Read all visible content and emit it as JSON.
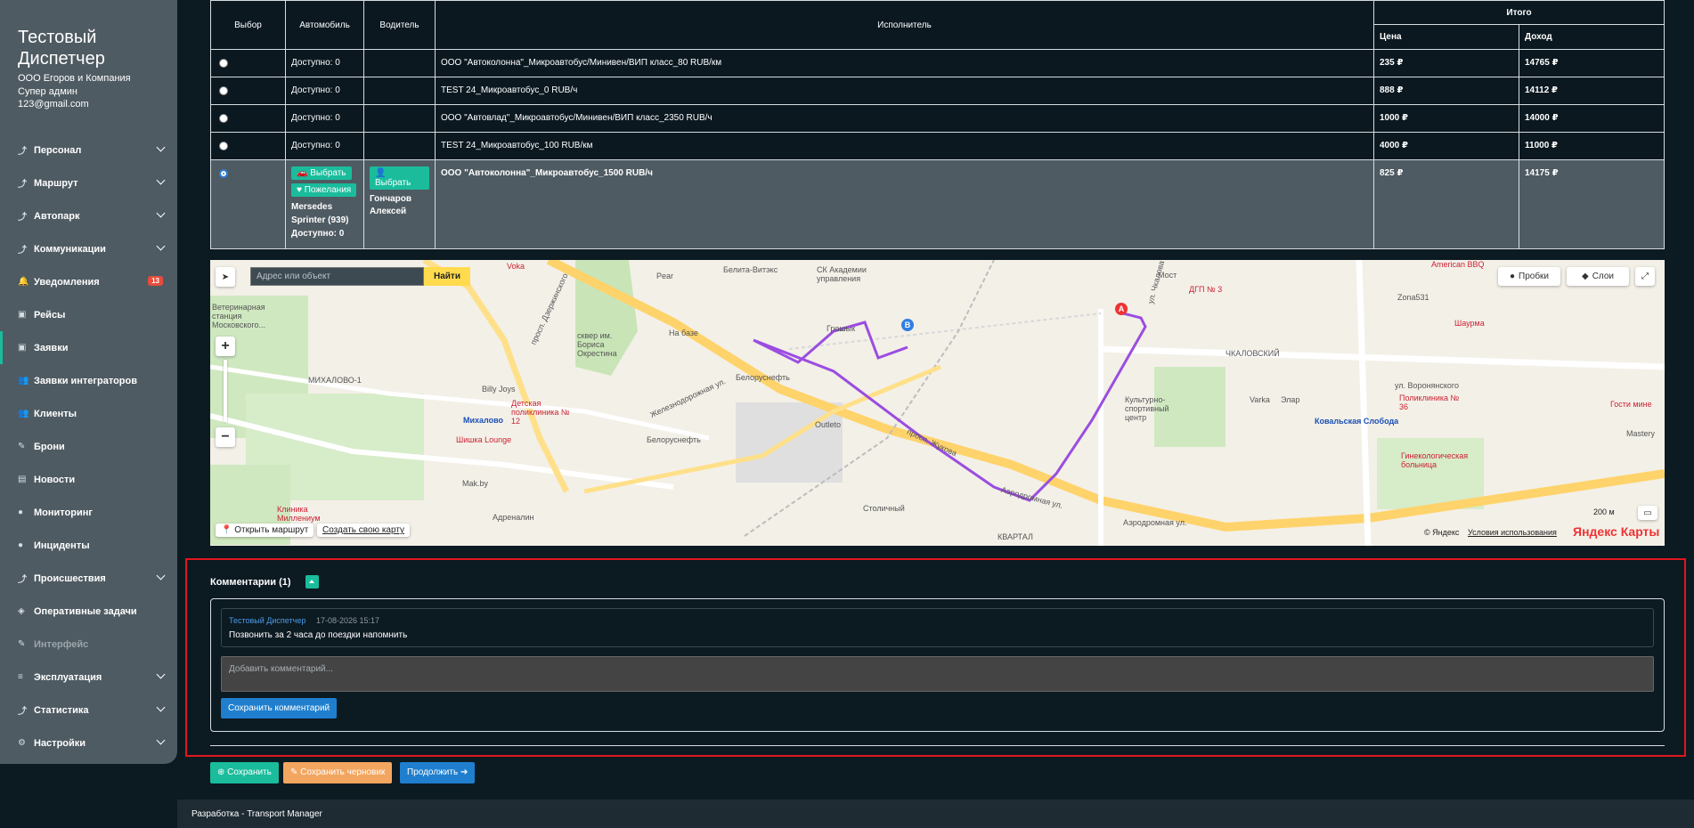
{
  "sidebar": {
    "title": "Тестовый Диспетчер",
    "org": "ООО Егоров и Компания",
    "role": "Супер админ",
    "email": "123@gmail.com",
    "items": [
      {
        "label": "Персонал",
        "icon": "route-icon",
        "chevron": true
      },
      {
        "label": "Маршрут",
        "icon": "route-icon",
        "chevron": true
      },
      {
        "label": "Автопарк",
        "icon": "route-icon",
        "chevron": true
      },
      {
        "label": "Коммуникации",
        "icon": "route-icon",
        "chevron": true
      },
      {
        "label": "Уведомления",
        "icon": "bell-icon",
        "badge": "13"
      },
      {
        "label": "Рейсы",
        "icon": "bus-icon"
      },
      {
        "label": "Заявки",
        "icon": "bus-icon",
        "active": true
      },
      {
        "label": "Заявки интеграторов",
        "icon": "users-icon"
      },
      {
        "label": "Клиенты",
        "icon": "users-icon"
      },
      {
        "label": "Брони",
        "icon": "edit-icon"
      },
      {
        "label": "Новости",
        "icon": "news-icon"
      },
      {
        "label": "Мониторинг",
        "icon": "pin-icon"
      },
      {
        "label": "Инциденты",
        "icon": "pin-icon"
      },
      {
        "label": "Происшествия",
        "icon": "route-icon",
        "chevron": true
      },
      {
        "label": "Оперативные задачи",
        "icon": "tag-icon"
      },
      {
        "label": "Интерфейс",
        "icon": "edit-icon",
        "disabled": true
      },
      {
        "label": "Эксплуатация",
        "icon": "list-icon",
        "chevron": true
      },
      {
        "label": "Статистика",
        "icon": "route-icon",
        "chevron": true
      },
      {
        "label": "Настройки",
        "icon": "gear-icon",
        "chevron": true
      }
    ]
  },
  "table": {
    "headers": {
      "choice": "Выбор",
      "car": "Автомобиль",
      "driver": "Водитель",
      "executor": "Исполнитель",
      "total": "Итого",
      "price": "Цена",
      "income": "Доход"
    },
    "rows": [
      {
        "car": "Доступно: 0",
        "executor": "ООО \"Автоколонна\"_Микроавтобус/Минивен/ВИП класс_80 RUB/км",
        "price": "235 ₽",
        "income": "14765 ₽"
      },
      {
        "car": "Доступно: 0",
        "executor": "TEST 24_Микроавтобус_0 RUB/ч",
        "price": "888 ₽",
        "income": "14112 ₽"
      },
      {
        "car": "Доступно: 0",
        "executor": "ООО \"Автовлад\"_Микроавтобус/Минивен/ВИП класс_2350 RUB/ч",
        "price": "1000 ₽",
        "income": "14000 ₽"
      },
      {
        "car": "Доступно: 0",
        "executor": "TEST 24_Микроавтобус_100 RUB/км",
        "price": "4000 ₽",
        "income": "11000 ₽"
      }
    ],
    "selected_row": {
      "car_select": "Выбрать",
      "car_wish": "Пожелания",
      "car_name": "Mersedes Sprinter (939)",
      "car_available": "Доступно: 0",
      "driver_select": "Выбрать",
      "driver_name": "Гончаров Алексей",
      "executor": "ООО \"Автоколонна\"_Микроавтобус_1500 RUB/ч",
      "price": "825 ₽",
      "income": "14175 ₽"
    }
  },
  "map": {
    "search_placeholder": "Адрес или объект",
    "find": "Найти",
    "traffic": "Пробки",
    "layers": "Слои",
    "open_route": "Открыть маршрут",
    "create_map": "Создать свою карту",
    "scale": "200 м",
    "copyright": "© Яндекс",
    "terms": "Условия использования",
    "logo": "Яндекс Карты",
    "labels": {
      "voka": "Voka",
      "belita": "Белита-Витэкс",
      "academy": "СК Академии управления",
      "most": "Мост",
      "dgp": "ДГП № 3",
      "bbq": "American BBQ",
      "zona": "Zona531",
      "vet": "Ветеринарная станция Московского...",
      "pear": "Pear",
      "skver": "сквер им. Бориса Окрестина",
      "grosh": "Грошык",
      "nabaze": "На базе",
      "mikhalovo1": "МИХАЛОВО-1",
      "billy": "Billy Joys",
      "poly12": "Детская поликлиника № 12",
      "mikhalovo": "Михалово",
      "shishka": "Шишка Lounge",
      "belneft1": "Белоруснефть",
      "belneft2": "Белоруснефть",
      "outleto": "Outleto",
      "mak": "Mak.by",
      "adrenalin": "Адреналин",
      "stolichny": "Столичный",
      "millenium": "Клиника Миллениум",
      "kvartal": "КВАРТАЛ",
      "chkalovsky": "ЧКАЛОВСКИЙ",
      "culture": "Культурно-спортивный центр",
      "varka": "Varka",
      "elar": "Элар",
      "koval": "Ковальская Слобода",
      "poly36": "Поликлиника № 36",
      "shaurma": "Шаурма",
      "gosti": "Гости мине",
      "gineko": "Гинекологическая больница",
      "mastery": "Mastery",
      "aerodrom": "Аэродромная ул.",
      "aerodrom2": "Аэродромная ул.",
      "zhukova": "просп. Жукова",
      "zheldor": "Железнодорожная ул.",
      "voronyan": "ул. Воронянского",
      "chkalova": "ул. Чкалова",
      "dzerzh": "просп. Дзержинского",
      "a_marker": "A",
      "b_marker": "B"
    }
  },
  "comments": {
    "title": "Комментарии (1)",
    "author": "Тестовый Диспетчер",
    "time": "17-08-2026 15:17",
    "text": "Позвонить за 2 часа до поездки напомнить",
    "placeholder": "Добавить комментарий...",
    "save": "Сохранить комментарий"
  },
  "actions": {
    "save": "⊕ Сохранить",
    "draft": "✎ Сохранить черновик",
    "next": "Продолжить ➔"
  },
  "footer": "Разработка - Transport Manager",
  "colors": {
    "accent": "#1abc9c",
    "primary": "#1f7fce",
    "warning": "#f3a65f",
    "route": "#9b4de0",
    "highlight_frame": "#e0161d"
  }
}
